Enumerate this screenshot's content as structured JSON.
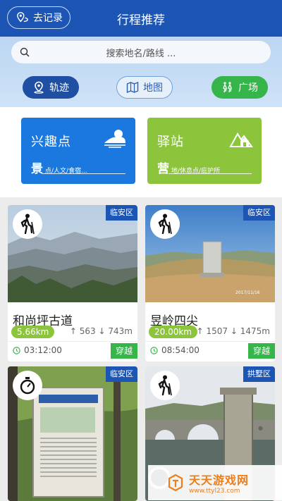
{
  "header": {
    "back_label": "去记录",
    "title": "行程推荐",
    "search_placeholder": "搜索地名/路线 ..."
  },
  "nav_pills": [
    {
      "label": "轨迹",
      "icon": "location-pin-icon"
    },
    {
      "label": "地图",
      "icon": "map-icon"
    },
    {
      "label": "广场",
      "icon": "hikers-icon"
    }
  ],
  "categories": [
    {
      "title": "兴趣点",
      "big": "景",
      "sub": "点/人文/食宿...",
      "icon": "landscape-icon",
      "color": "#1a78de"
    },
    {
      "title": "驿站",
      "big": "营",
      "sub": "地/休息点/庇护所",
      "icon": "shelter-icon",
      "color": "#8cc43c"
    }
  ],
  "routes": [
    {
      "name": "和尚坪古道",
      "region": "临安区",
      "distance": "5.66km",
      "ascent": "563",
      "descent": "743m",
      "time": "03:12:00",
      "type": "穿越",
      "mode_icon": "hiker-icon"
    },
    {
      "name": "昱岭四尖",
      "region": "临安区",
      "distance": "20.00km",
      "ascent": "1507",
      "descent": "1475m",
      "time": "08:54:00",
      "type": "穿越",
      "mode_icon": "hiker-icon"
    },
    {
      "name": "",
      "region": "临安区",
      "mode_icon": "stopwatch-icon"
    },
    {
      "name": "",
      "region": "拱墅区",
      "mode_icon": "hiker-icon"
    }
  ],
  "watermark": {
    "main": "天天游戏网",
    "url": "www.ttyl23.com"
  },
  "colors": {
    "brand_blue": "#1d55b5",
    "green": "#35b54a",
    "lime": "#8cc43c",
    "poi_blue": "#1a78de"
  }
}
